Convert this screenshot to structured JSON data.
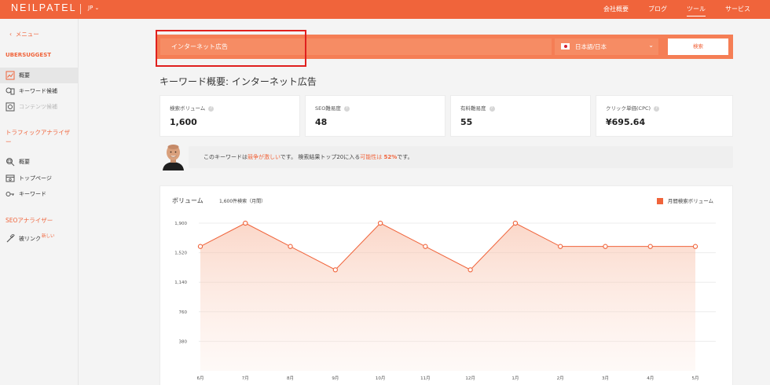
{
  "brand": {
    "logo": "NEILPATEL",
    "lang_switch": "JP",
    "accent": "#f0643b"
  },
  "nav": [
    "会社概要",
    "ブログ",
    "ツール",
    "サービス"
  ],
  "sidebar": {
    "back": "メニュー",
    "sections": [
      {
        "title": "UBERSUGGEST",
        "items": [
          {
            "label": "概要",
            "icon": "overview-icon",
            "active": true
          },
          {
            "label": "キーワード候補",
            "icon": "keyword-ideas-icon"
          },
          {
            "label": "コンテンツ候補",
            "icon": "content-ideas-icon",
            "disabled": true
          }
        ]
      },
      {
        "title": "トラフィックアナライザー",
        "items": [
          {
            "label": "概要",
            "icon": "traffic-overview-icon"
          },
          {
            "label": "トップページ",
            "icon": "top-pages-icon"
          },
          {
            "label": "キーワード",
            "icon": "key-icon"
          }
        ]
      },
      {
        "title": "SEOアナライザー",
        "items": [
          {
            "label": "被リンク",
            "icon": "link-icon",
            "badge": "新しい"
          }
        ]
      }
    ]
  },
  "search": {
    "keyword": "インターネット広告",
    "locale": "日本語/日本",
    "button": "検索"
  },
  "page_title": "キーワード概要: インターネット広告",
  "metrics": [
    {
      "label": "検索ボリューム",
      "value": "1,600"
    },
    {
      "label": "SEO難易度",
      "value": "48"
    },
    {
      "label": "有料難易度",
      "value": "55"
    },
    {
      "label": "クリック単価(CPC)",
      "value": "¥695.64"
    }
  ],
  "banner": {
    "pre": "このキーワードは",
    "hl1": "競争が激しい",
    "mid": "です。 検索結果トップ20に入る",
    "hl2": "可能性は",
    "pct": "52%",
    "post": "です。"
  },
  "chart": {
    "title": "ボリューム",
    "subtitle": "1,600件検索（月間）",
    "legend": "月間検索ボリューム"
  },
  "chart_data": {
    "type": "area",
    "categories": [
      "6月",
      "7月",
      "8月",
      "9月",
      "10月",
      "11月",
      "12月",
      "1月",
      "2月",
      "3月",
      "4月",
      "5月"
    ],
    "series": [
      {
        "name": "月間検索ボリューム",
        "values": [
          1600,
          1900,
          1600,
          1300,
          1900,
          1600,
          1300,
          1900,
          1600,
          1600,
          1600,
          1600
        ]
      }
    ],
    "yticks": [
      "1,900",
      "1,520",
      "1,140",
      "760",
      "380"
    ],
    "ylim": [
      0,
      1900
    ],
    "grid": true,
    "legend_position": "top-right",
    "color": "#f0643b"
  }
}
